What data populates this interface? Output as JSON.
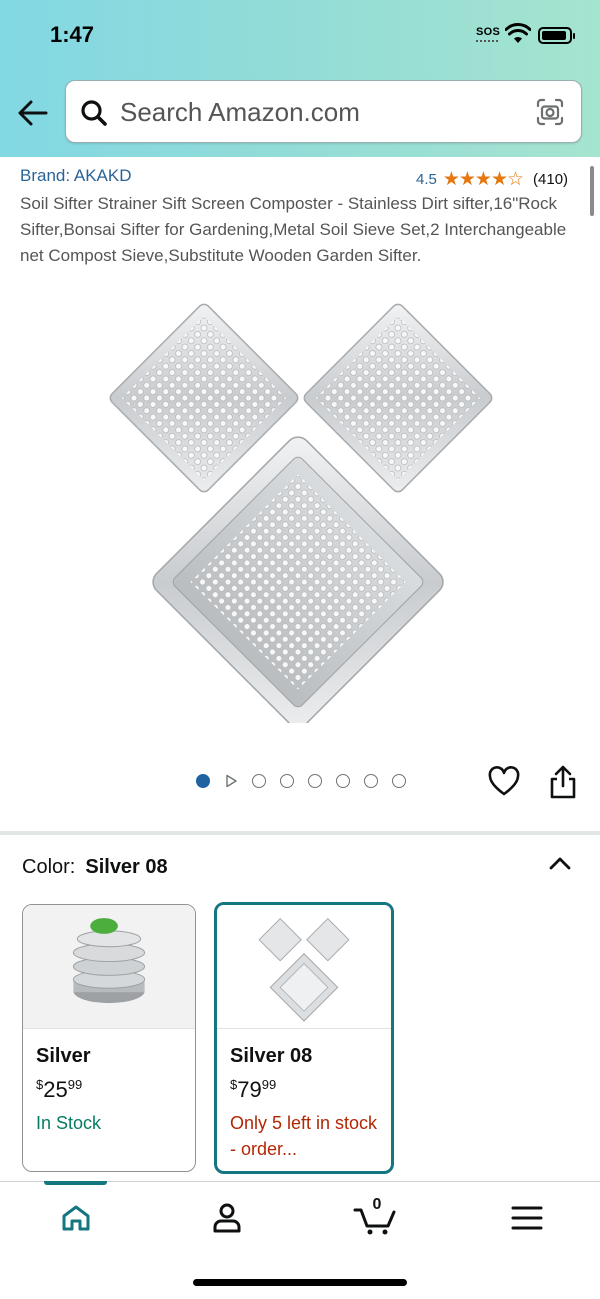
{
  "status_bar": {
    "time": "1:47",
    "sos": "SOS"
  },
  "search": {
    "placeholder": "Search Amazon.com"
  },
  "product": {
    "brand": "Brand: AKAKD",
    "rating": "4.5",
    "stars": "★★★★☆",
    "review_count": "(410)",
    "title": "Soil Sifter Strainer Sift Screen Composter - Stainless Dirt sifter,16\"Rock Sifter,Bonsai Sifter for Gardening,Metal Soil Sieve Set,2 Interchangeable net Compost Sieve,Substitute Wooden Garden Sifter."
  },
  "carousel": {
    "total_items": 8,
    "active_index": 0
  },
  "color_selector": {
    "label": "Color:",
    "selected": "Silver 08",
    "options": [
      {
        "name": "Silver",
        "price_symbol": "$",
        "price_whole": "25",
        "price_fraction": "99",
        "availability": "In Stock",
        "selected": false
      },
      {
        "name": "Silver 08",
        "price_symbol": "$",
        "price_whole": "79",
        "price_fraction": "99",
        "availability": "Only 5 left in stock - order...",
        "selected": true
      }
    ]
  },
  "bottom_nav": {
    "items": [
      "home-icon",
      "profile-icon",
      "cart-icon",
      "menu-icon"
    ],
    "cart_count": "0",
    "active": "home"
  },
  "colors": {
    "header_gradient_start": "#82d8e3",
    "header_gradient_end": "#a5e4cf",
    "link_blue": "#2a6496",
    "star_orange": "#e47911",
    "teal_accent": "#137680",
    "in_stock_green": "#067d62",
    "low_stock_red": "#b12704"
  }
}
